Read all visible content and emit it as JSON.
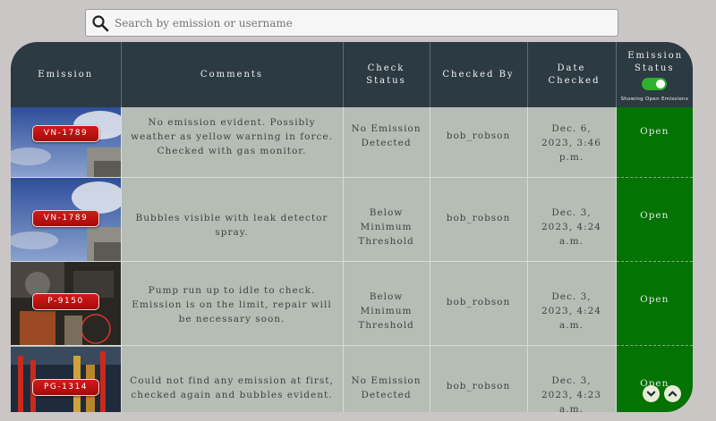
{
  "search": {
    "placeholder": "Search by emission or username"
  },
  "table": {
    "headers": {
      "emission": "Emission",
      "comments": "Comments",
      "check_status": "Check Status",
      "checked_by": "Checked By",
      "date_checked": "Date Checked",
      "emission_status": "Emission Status"
    },
    "toggle_label": "Showing Open Emissions",
    "rows": [
      {
        "tag": "VN-1789",
        "comment": "No emission evident. Possibly weather as yellow warning in force. Checked with gas monitor.",
        "check_status": "No Emission Detected",
        "checked_by": "bob_robson",
        "date": "Dec. 6, 2023, 3:46 p.m.",
        "status": "Open"
      },
      {
        "tag": "VN-1789",
        "comment": "Bubbles visible with leak detector spray.",
        "check_status": "Below Minimum Threshold",
        "checked_by": "bob_robson",
        "date": "Dec. 3, 2023, 4:24 a.m.",
        "status": "Open"
      },
      {
        "tag": "P-9150",
        "comment": "Pump run up to idle to check. Emission is on the limit, repair will be necessary soon.",
        "check_status": "Below Minimum Threshold",
        "checked_by": "bob_robson",
        "date": "Dec. 3, 2023, 4:24 a.m.",
        "status": "Open"
      },
      {
        "tag": "PG-1314",
        "comment": "Could not find any emission at first, checked again and bubbles evident.",
        "check_status": "No Emission Detected",
        "checked_by": "bob_robson",
        "date": "Dec. 3, 2023, 4:23 a.m.",
        "status": "Open"
      }
    ]
  },
  "colors": {
    "header_bg": "#2c3a42",
    "row_bg": "#b6bdb5",
    "status_open": "#037303",
    "tag_red": "#c01414",
    "toggle_on": "#2fb12f"
  },
  "icons": {
    "search": "search-icon",
    "scroll_down": "chevron-down-icon",
    "scroll_up": "chevron-up-icon"
  }
}
